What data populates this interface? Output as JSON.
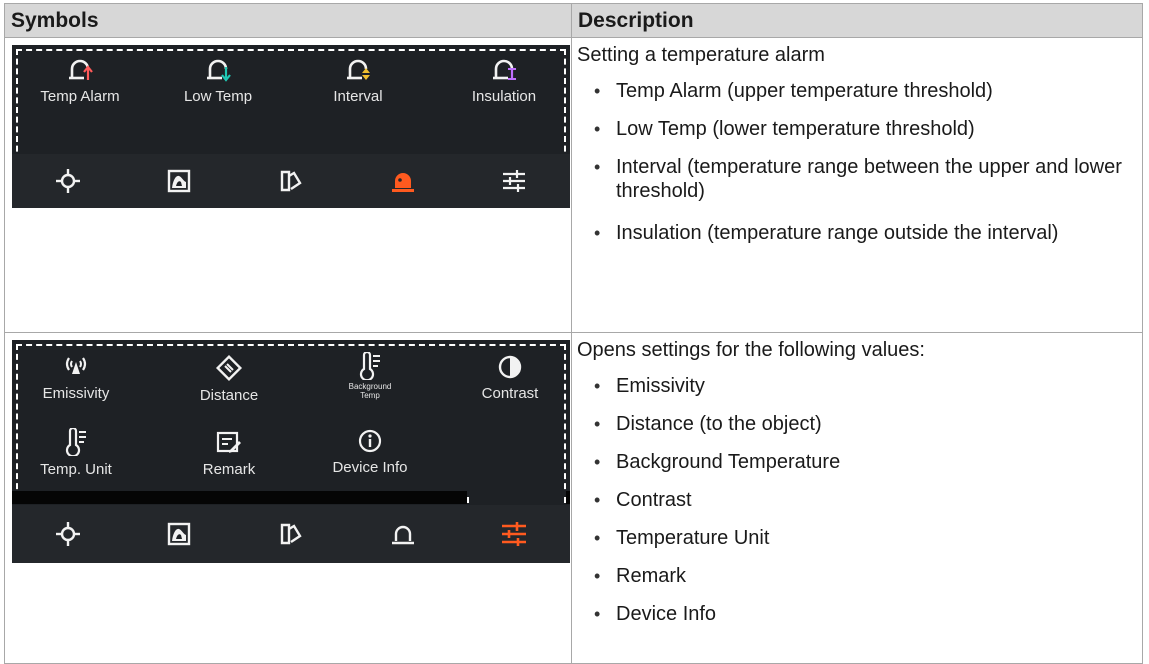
{
  "table": {
    "header": {
      "symbols": "Symbols",
      "description": "Description"
    }
  },
  "alarm_row": {
    "items": [
      {
        "label": "Temp Alarm",
        "icon": "alarm-up-icon",
        "accent": "#ff5a5a"
      },
      {
        "label": "Low Temp",
        "icon": "alarm-down-icon",
        "accent": "#1fc8b4"
      },
      {
        "label": "Interval",
        "icon": "alarm-interval-icon",
        "accent": "#f0c030"
      },
      {
        "label": "Insulation",
        "icon": "alarm-insulation-icon",
        "accent": "#c070ff"
      }
    ],
    "description": {
      "intro": "Setting a temperature alarm",
      "bullets": [
        "Temp Alarm (upper temperature threshold)",
        "Low Temp (lower temperature threshold)",
        "Interval (temperature range between the upper and lower threshold)",
        "Insulation (temperature range outside the interval)"
      ]
    }
  },
  "settings_row": {
    "items": [
      {
        "label": "Emissivity",
        "icon": "emissivity-icon"
      },
      {
        "label": "Distance",
        "icon": "distance-icon"
      },
      {
        "label": "Background Temp",
        "icon": "thermometer-icon"
      },
      {
        "label": "Contrast",
        "icon": "contrast-icon"
      },
      {
        "label": "Temp. Unit",
        "icon": "thermometer-icon"
      },
      {
        "label": "Remark",
        "icon": "remark-icon"
      },
      {
        "label": "Device Info",
        "icon": "info-icon"
      }
    ],
    "description": {
      "intro": "Opens settings for the following values:",
      "bullets": [
        "Emissivity",
        "Distance (to the object)",
        "Background Temperature",
        "Contrast",
        "Temperature Unit",
        "Remark",
        "Device Info"
      ]
    }
  },
  "nav": {
    "icons": [
      "crosshair-icon",
      "image-icon",
      "palette-icon",
      "alarm-icon",
      "sliders-icon"
    ],
    "active_color": "#ff5a1f",
    "icon_color": "#f2f2f2"
  }
}
